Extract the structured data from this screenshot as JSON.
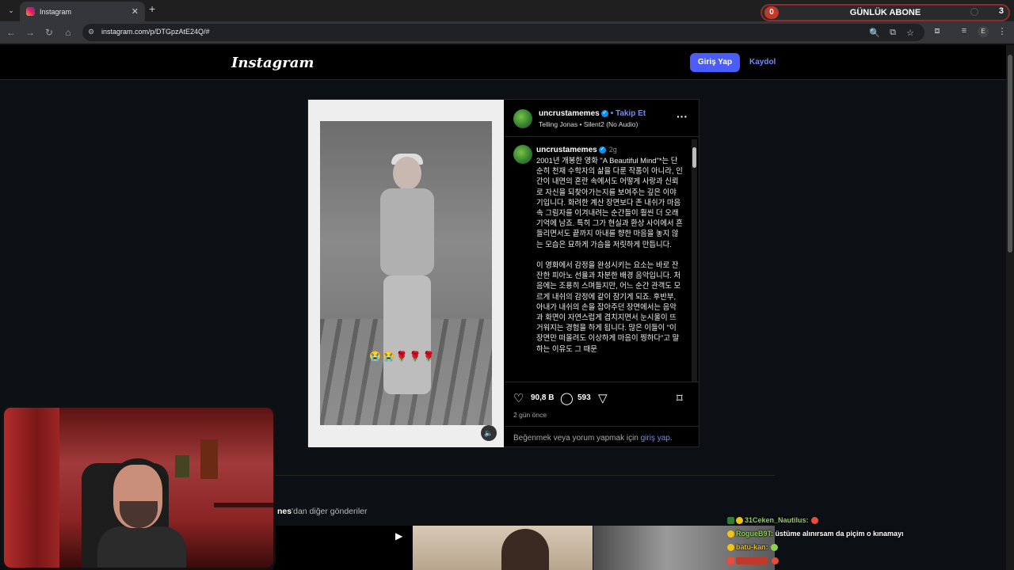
{
  "browser": {
    "tab_title": "Instagram",
    "url": "instagram.com/p/DTGpzAtE24Q/#",
    "profile_initial": "E"
  },
  "subscriber_widget": {
    "label": "GÜNLÜK ABONE",
    "left_count": "0",
    "right_count": "3"
  },
  "header": {
    "logo": "Instagram",
    "login_label": "Giriş Yap",
    "signup_label": "Kaydol"
  },
  "post": {
    "author": "uncrustamemes",
    "follow_label": "• Takip Et",
    "audio": "Telling Jonas • Silent2 (No Audio)",
    "caption_author": "uncrustamemes",
    "caption_time": "2g",
    "caption": "2001년 개봉한 영화 \"A Beautiful Mind\"*는 단순히 천재 수학자의 삶을 다룬 작품이 아니라, 인간이 내면의 혼란 속에서도 어떻게 사랑과 신뢰로 자신을 되찾아가는지를 보여주는 깊은 이야기입니다. 화려한 계산 장면보다 존 내쉬가 마음속 그림자를 이겨내려는 순간들이 훨씬 더 오래 기억에 남죠. 특히 그가 현실과 환상 사이에서 흔들리면서도 끝까지 아내를 향한 마음을 놓지 않는 모습은 묘하게 가슴을 저릿하게 만듭니다.\n\n이 영화에서 감정을 완성시키는 요소는 바로 잔잔한 피아노 선율과 차분한 배경 음악입니다. 처음에는 조용히 스며들지만, 어느 순간 관객도 모르게 내쉬의 감정에 같이 잠기게 되죠. 후반부, 아내가 내쉬의 손을 잡아주던 장면에서는 음악과 화면이 자연스럽게 겹치지면서 눈시울이 뜨거워지는 경험을 하게 됩니다. 많은 이들이 \"이 장면만 떠올려도 이상하게 마음이 찡하다\"고 말하는 이유도 그 때문",
    "video_emojis": "😭😭🌹🌹🌹",
    "likes": "90,8 B",
    "comments": "593",
    "time_ago": "2 gün önce",
    "login_prompt_prefix": "Beğenmek veya yorum yapmak için ",
    "login_prompt_link": "giriş yap",
    "login_prompt_suffix": "."
  },
  "more_posts": {
    "partial_name": "nes",
    "suffix": "'dan diğer gönderiler"
  },
  "chat": [
    {
      "user": "31Ceken_Nautilus:",
      "message": "",
      "user_color": "#8fd14f"
    },
    {
      "user": "RogueB9T:",
      "message": "üstüme alınırsam da piçim o kınamayı",
      "user_color": "#8fd14f"
    },
    {
      "user": "batu-kan:",
      "message": "",
      "user_color": "#f1c40f"
    },
    {
      "user": "",
      "message": "",
      "user_color": "#e74c3c"
    }
  ]
}
